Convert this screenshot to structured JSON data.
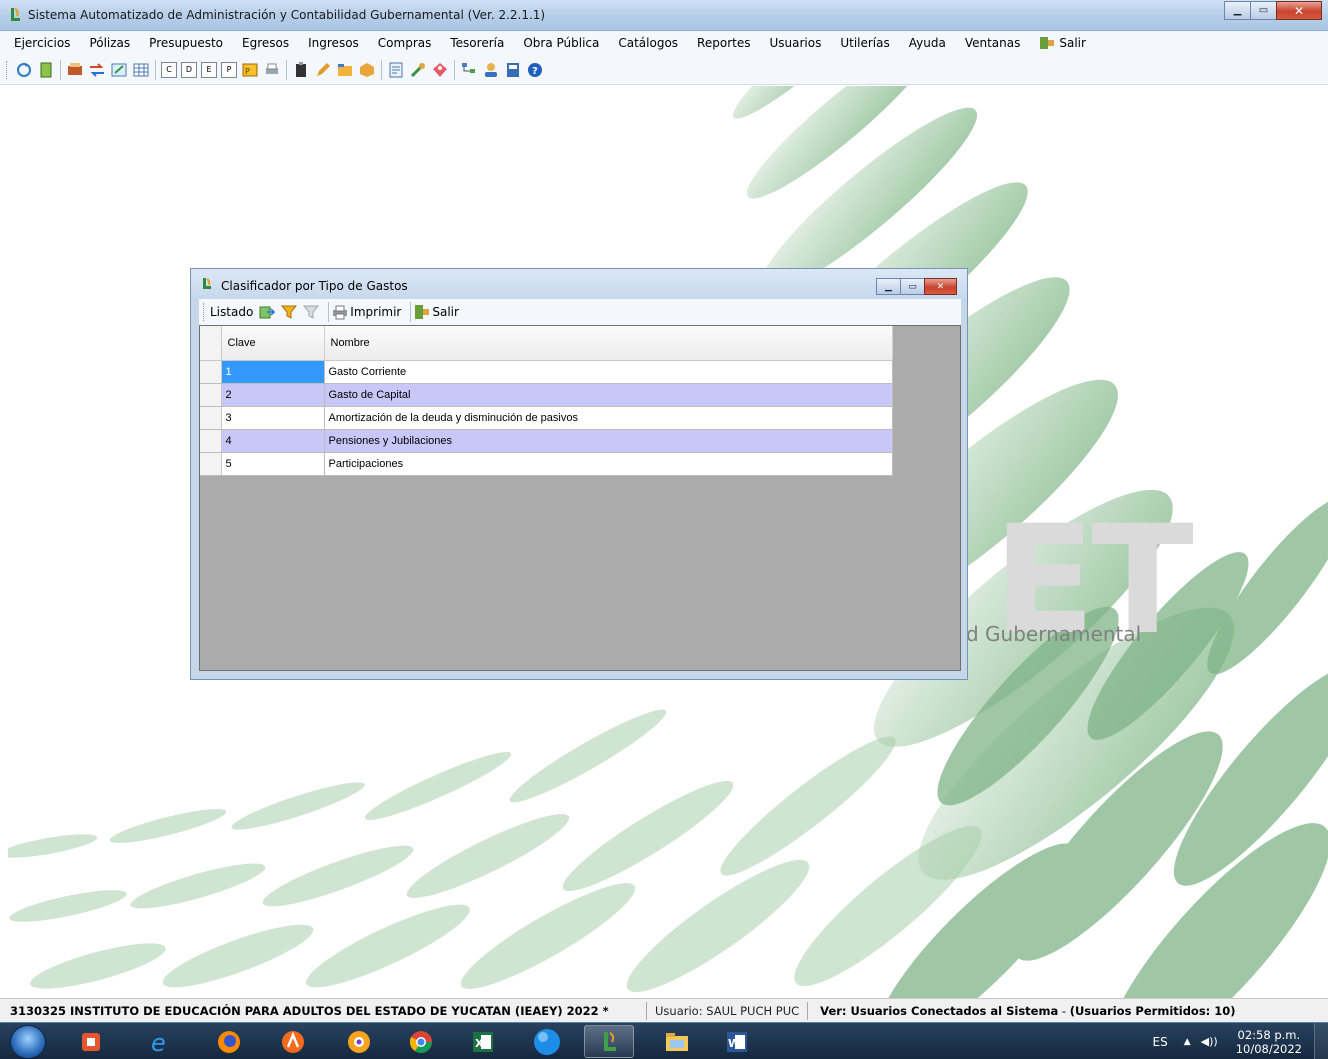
{
  "window": {
    "title": "Sistema Automatizado de Administración y Contabilidad Gubernamental  (Ver. 2.2.1.1)"
  },
  "menu": [
    "Ejercicios",
    "Pólizas",
    "Presupuesto",
    "Egresos",
    "Ingresos",
    "Compras",
    "Tesorería",
    "Obra Pública",
    "Catálogos",
    "Reportes",
    "Usuarios",
    "Utilerías",
    "Ayuda",
    "Ventanas",
    "Salir"
  ],
  "toolbar_letters": [
    "C",
    "D",
    "E",
    "P"
  ],
  "background": {
    "logo_text": "ET",
    "logo_subtitle": "d Gubernamental",
    "accent_color": "#8fbf95"
  },
  "child_window": {
    "title": "Clasificador por Tipo de Gastos",
    "toolbar": {
      "listado": "Listado",
      "imprimir": "Imprimir",
      "salir": "Salir"
    },
    "grid": {
      "columns": [
        "Clave",
        "Nombre"
      ],
      "rows": [
        {
          "clave": "1",
          "nombre": "Gasto Corriente"
        },
        {
          "clave": "2",
          "nombre": "Gasto de Capital"
        },
        {
          "clave": "3",
          "nombre": "Amortización de la deuda y disminución de pasivos"
        },
        {
          "clave": "4",
          "nombre": "Pensiones y Jubilaciones"
        },
        {
          "clave": "5",
          "nombre": "Participaciones"
        }
      ]
    }
  },
  "status": {
    "company": "3130325 INSTITUTO DE EDUCACIÓN PARA ADULTOS DEL ESTADO DE YUCATAN (IEAEY)  2022  *",
    "user": "Usuario: SAUL PUCH PUC",
    "connected_prefix": "Ver: Usuarios Conectados al Sistema",
    "connected_sep": " - ",
    "permitted": "(Usuarios Permitidos: 10)"
  },
  "taskbar": {
    "lang": "ES",
    "time": "02:58 p.m.",
    "date": "10/08/2022"
  }
}
